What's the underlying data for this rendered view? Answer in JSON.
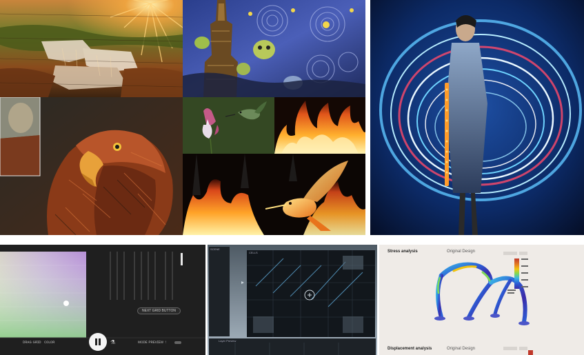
{
  "collage": {
    "tiles": [
      {
        "name": "waterfall-sunburst-painting"
      },
      {
        "name": "deep-dream-starry-night"
      },
      {
        "name": "light-sculpture-dress-photo"
      },
      {
        "name": "eagle-oil-painting"
      },
      {
        "name": "hummingbird-columbine-photo"
      },
      {
        "name": "flames-photo"
      },
      {
        "name": "fire-hummingbird-render"
      }
    ]
  },
  "color_tool": {
    "button_label": "NEXT GRID BUTTON",
    "footer": {
      "left_text_1": "ᴅʀᴀɢ ɢʀɪᴅ",
      "left_text_2": "ᴄᴏʟᴏʀ",
      "right_text": "ᴍᴏᴅᴇ ᴘʀᴇᴠɪᴇᴡ ↑",
      "play_icon": "pause-icon"
    }
  },
  "grid_tool": {
    "left_panel_title": "SCENE",
    "main_panel_title": "CELLS",
    "bottom_panel_title": "Layer Preview"
  },
  "stress_figure": {
    "title_stress": "Stress analysis",
    "subtitle_stress": "Original Design",
    "title_displacement": "Displacement analysis",
    "subtitle_displacement": "Original Design",
    "colorbar_colors": [
      "#c0392b",
      "#e67e22",
      "#f1c40f",
      "#7ed957",
      "#3bb6e5",
      "#2c5fd6",
      "#3a2aa8"
    ]
  }
}
